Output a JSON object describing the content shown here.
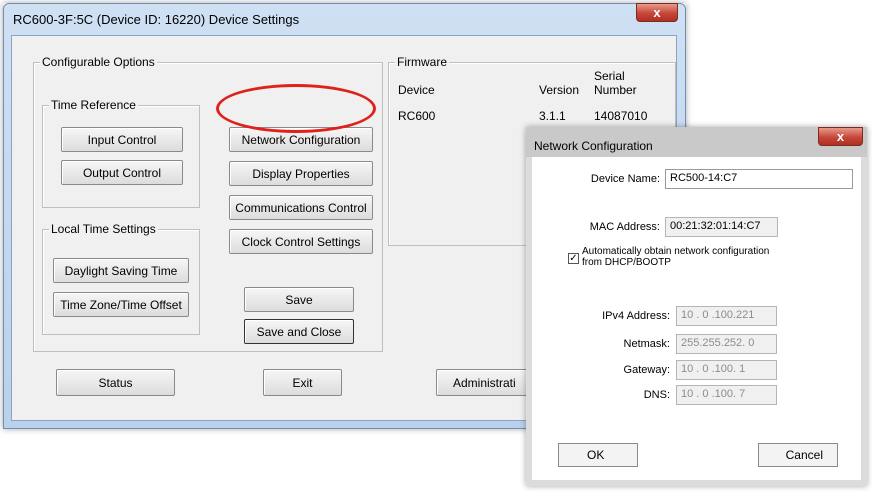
{
  "main": {
    "title": "RC600-3F:5C (Device ID: 16220) Device Settings",
    "close_symbol": "x",
    "configurable_options": {
      "label": "Configurable Options",
      "time_reference": {
        "label": "Time Reference",
        "input_control": "Input Control",
        "output_control": "Output Control"
      },
      "local_time": {
        "label": "Local Time Settings",
        "daylight_saving": "Daylight Saving Time",
        "time_zone": "Time Zone/Time Offset"
      },
      "network_configuration": "Network Configuration",
      "display_properties": "Display Properties",
      "communications_control": "Communications Control",
      "clock_control_settings": "Clock Control Settings",
      "save": "Save",
      "save_and_close": "Save and Close"
    },
    "firmware": {
      "label": "Firmware",
      "col_device": "Device",
      "col_version": "Version",
      "col_serial_1": "Serial",
      "col_serial_2": "Number",
      "device": "RC600",
      "version": "3.1.1",
      "serial": "14087010"
    },
    "bottom": {
      "status": "Status",
      "exit": "Exit",
      "administration": "Administrati"
    }
  },
  "netconfig": {
    "title": "Network Configuration",
    "close_symbol": "x",
    "device_name_label": "Device Name:",
    "device_name_value": "RC500-14:C7",
    "mac_label": "MAC Address:",
    "mac_value": "00:21:32:01:14:C7",
    "dhcp_checked": true,
    "dhcp_text_1": "Automatically obtain network configuration",
    "dhcp_text_2": "from DHCP/BOOTP",
    "ipv4_label": "IPv4 Address:",
    "ipv4_value": "10 . 0 .100.221",
    "netmask_label": "Netmask:",
    "netmask_value": "255.255.252. 0",
    "gateway_label": "Gateway:",
    "gateway_value": "10 . 0 .100. 1",
    "dns_label": "DNS:",
    "dns_value": "10 . 0 .100. 7",
    "ok": "OK",
    "cancel": "Cancel"
  },
  "colors": {
    "highlight_ring": "#e0211a",
    "close_button": "#c6473a",
    "title_bar": "#b9d1ec"
  }
}
